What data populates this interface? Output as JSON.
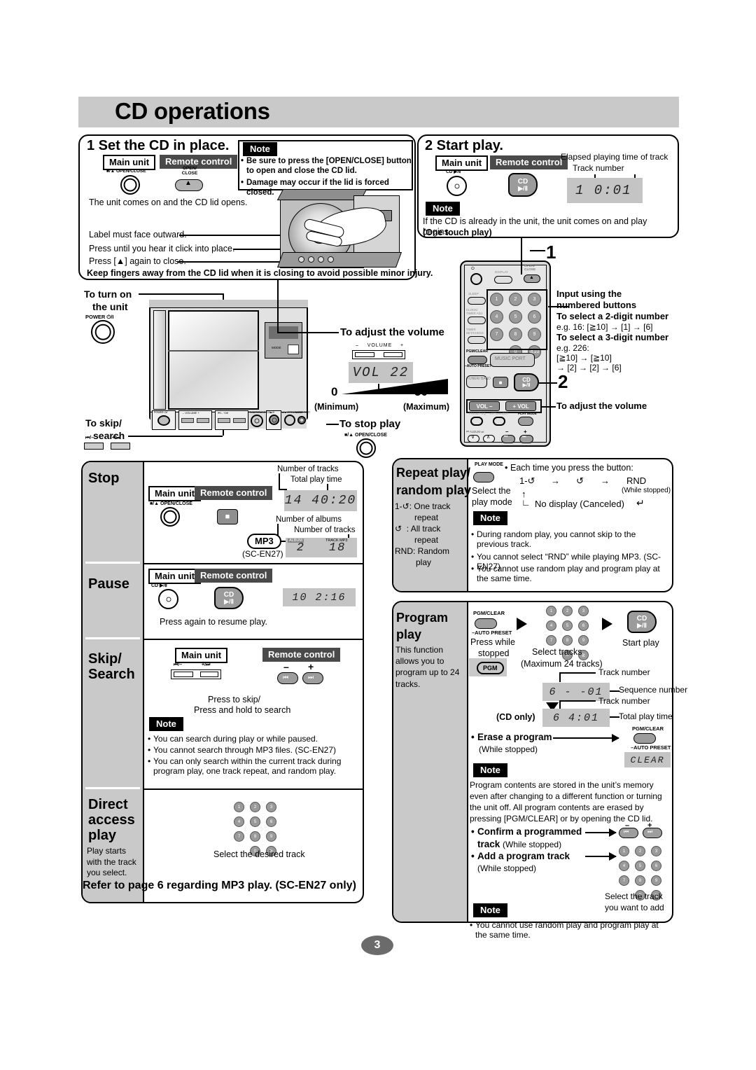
{
  "header": {
    "title": "CD operations"
  },
  "page_number": "3",
  "step1": {
    "title": "1 Set the CD in place.",
    "main_unit": "Main unit",
    "remote_control": "Remote control",
    "main_btn_label": "■/▲ OPEN/CLOSE",
    "remote_btn_label": "OPEN/ CLOSE",
    "line_unit_comes_on": "The unit comes on and the CD lid opens.",
    "label_outward": "Label must face outward.",
    "press_click": "Press until you hear it click into place.",
    "press_again": "Press [▲] again to close.",
    "warning": "Keep fingers away from the CD lid when it is closing to avoid possible minor injury.",
    "note_title": "Note",
    "note_items": [
      "Be sure to press the [OPEN/CLOSE] button to open and close the CD lid.",
      "Damage may occur if the lid is forced closed."
    ]
  },
  "step2": {
    "title": "2 Start play.",
    "main_unit": "Main unit",
    "remote_control": "Remote control",
    "main_btn_label": "CD ▶/Ⅱ",
    "remote_btn_line1": "CD",
    "remote_btn_line2": "▶/Ⅱ",
    "callout_elapsed": "Elapsed playing time of track",
    "callout_track": "Track number",
    "display_value": "1      0:01",
    "note_title": "Note",
    "note_text": "If the CD is already in the unit, the unit comes on and play begins.",
    "one_touch": "(One touch play)"
  },
  "unit_callouts": {
    "to_turn_on": "To turn on",
    "the_unit": "the unit",
    "power_label": "POWER ⏻/I",
    "to_skip_search": "To skip/",
    "search": "search",
    "skip_label_left": "⏮/–",
    "skip_label_right": "+/⏭",
    "to_adjust_volume": "To adjust the volume",
    "volume_minus": "–",
    "volume_label": "VOLUME",
    "volume_plus": "+",
    "volume_display": "VOL 22",
    "min_value": "0",
    "min_label": "(Minimum)",
    "max_value": "50",
    "max_label": "(Maximum)",
    "to_stop_play": "To stop play",
    "stop_btn_label": "■/▲ OPEN/CLOSE"
  },
  "remote_callouts": {
    "marker_1": "1",
    "marker_2": "2",
    "input_using": "Input using the",
    "numbered_buttons": "numbered buttons",
    "select_2digit": "To select a 2-digit number",
    "eg_16": "e.g. 16: [≧10] → [1] → [6]",
    "select_3digit": "To select a 3-digit number",
    "eg_226": "e.g. 226:",
    "eg_226_line1": "[≧10] → [≧10]",
    "eg_226_line2": "→ [2] → [2] → [6]",
    "to_adjust_volume": "To adjust the volume",
    "btn_display": "DISPLAY",
    "btn_open_close": "OPEN/ CLOSE",
    "btn_sleep": "SLEEP",
    "btn_clock": "CLOCK/",
    "btn_timer_adj": "TIMER ADJ",
    "btn_timer": "TIMER",
    "btn_set_check": "SET/CHECK",
    "btn_pgm_clear": "PGM/CLEAR",
    "btn_auto_preset": "–AUTO PRESET",
    "btn_music_port": "MUSIC PORT",
    "btn_tuner_band": "TUNER/ BAND",
    "btn_cd": "CD",
    "btn_cd2": "▶/Ⅱ",
    "btn_vol_minus": "VOL –",
    "btn_vol_plus": "+ VOL",
    "btn_preset_eq": "PRESET EQ",
    "btn_virtualizer": "VIRTUALIZER",
    "btn_play_mode": "PLAY MODE",
    "btn_album_row": "⏮ ALBUM ⏭",
    "btn_minus": "–",
    "btn_plus": "+"
  },
  "ops": {
    "stop": {
      "label": "Stop",
      "main_unit": "Main unit",
      "remote_control": "Remote control",
      "main_btn_label": "■/▲ OPEN/CLOSE",
      "callout_tracks": "Number of tracks",
      "callout_total": "Total play time",
      "display_value": "14   40:20",
      "mp3_badge": "MP3",
      "mp3_model": "(SC-EN27)",
      "callout_albums": "Number of albums",
      "callout_tracks2": "Number of tracks",
      "mp3_display_left": "2",
      "mp3_display_right": "18",
      "mp3_tag_left": "ALBUM",
      "mp3_tag_right": "TRACK MP3"
    },
    "pause": {
      "label": "Pause",
      "main_unit": "Main unit",
      "remote_control": "Remote control",
      "main_btn_label": "CD ▶/Ⅱ",
      "remote_btn_line1": "CD",
      "remote_btn_line2": "▶/Ⅱ",
      "display_value": "10   2:16",
      "press_again": "Press again to resume play."
    },
    "skip": {
      "label_l1": "Skip/",
      "label_l2": "Search",
      "main_unit": "Main unit",
      "remote_control": "Remote control",
      "main_left": "⏮/–",
      "main_right": "+/⏭",
      "remote_minus": "–",
      "remote_plus": "+",
      "press_to_skip": "Press to skip/",
      "press_hold": "Press and hold to search",
      "note_title": "Note",
      "note_items": [
        "You can search during play or while paused.",
        "You cannot search through MP3 files. (SC-EN27)",
        "You can only search within the current track during program play, one track repeat, and random play."
      ]
    },
    "direct": {
      "label_l1": "Direct",
      "label_l2": "access",
      "label_l3": "play",
      "desc": "Play starts with the track you select.",
      "select_track": "Select the desired track"
    },
    "footer_note": "Refer to page 6 regarding MP3 play. (SC-EN27 only)"
  },
  "repeat": {
    "title_l1": "Repeat play/",
    "title_l2": "random play",
    "legend": [
      {
        "sym": "1-↺",
        "txt": ": One track",
        "txt2": "repeat"
      },
      {
        "sym": "↺",
        "txt": ": All track",
        "txt2": "repeat"
      },
      {
        "sym": "RND",
        "txt": ": Random",
        "txt2": "play"
      }
    ],
    "play_mode_label": "PLAY MODE",
    "select_l1": "Select the",
    "select_l2": "play mode",
    "each_time": "Each time you press the button:",
    "seq_1": "1-↺",
    "seq_2": "↺",
    "seq_3": "RND",
    "while_stopped": "(While stopped)",
    "no_display": "No display (Canceled)",
    "note_title": "Note",
    "note_items": [
      "During random play, you cannot skip to the previous track.",
      "You cannot select “RND” while playing MP3. (SC-EN27)",
      "You cannot use random play and program play at the same time."
    ]
  },
  "program": {
    "title_l1": "Program",
    "title_l2": "play",
    "desc": "This function allows you to program up to 24 tracks.",
    "pgm_clear": "PGM/CLEAR",
    "auto_preset": "–AUTO PRESET",
    "press_while": "Press while",
    "stopped": "stopped",
    "pgm_badge": "PGM",
    "select_tracks": "Select tracks",
    "max_tracks": "(Maximum 24 tracks)",
    "start_play": "Start play",
    "cd_btn_l1": "CD",
    "cd_btn_l2": "▶/Ⅱ",
    "callout_track_number": "Track number",
    "callout_sequence": "Sequence number",
    "display1": "6    - -01",
    "callout_track_number2": "Track number",
    "callout_total_time": "Total play time",
    "cd_only": "(CD only)",
    "display2": "6    4:01",
    "erase_title": "Erase a program",
    "erase_sub": "(While stopped)",
    "clear_display": "CLEAR",
    "note_title": "Note",
    "note_text": "Program contents are stored in the unit’s memory even after changing to a different function or turning the unit off. All program contents are erased by pressing [PGM/CLEAR] or by opening the CD lid.",
    "confirm_title": "Confirm a programmed",
    "confirm_title2": "track",
    "confirm_sub": "(While stopped)",
    "confirm_minus": "–",
    "confirm_plus": "+",
    "add_title": "Add a program track",
    "add_sub": "(While stopped)",
    "select_add_l1": "Select the track",
    "select_add_l2": "you want to add",
    "note2_title": "Note",
    "note2_text": "You cannot use random play and program play at the same time."
  },
  "colors": {
    "header_band": "#c9c9c9",
    "lcd": "#c4c4c4",
    "remote_chip": "#4a4a4a",
    "note_chip": "#000000",
    "grey_band": "#c9c9c9"
  }
}
